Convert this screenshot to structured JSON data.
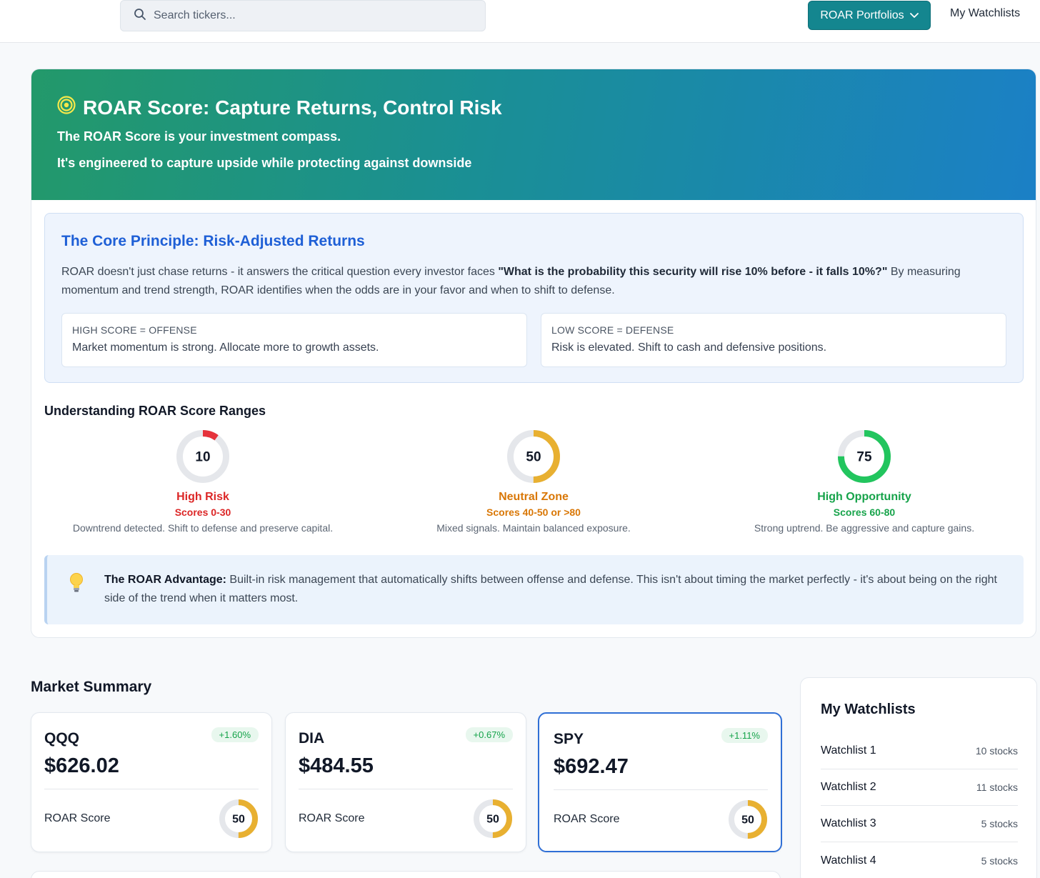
{
  "topbar": {
    "search_placeholder": "Search tickers...",
    "portfolios_label": "ROAR Portfolios",
    "watchlists_label": "My Watchlists"
  },
  "hero": {
    "title": "ROAR Score: Capture Returns, Control Risk",
    "subtitle1": "The ROAR Score is your investment compass.",
    "subtitle2": "It's engineered to capture upside while protecting against downside"
  },
  "principle": {
    "heading": "The Core Principle: Risk-Adjusted Returns",
    "text_before": "ROAR doesn't just chase returns - it answers the critical question every investor faces ",
    "question": "\"What is the probability this security will rise 10% before - it falls 10%?\"",
    "text_after": " By measuring momentum and trend strength, ROAR identifies when the odds are in your favor and when to shift to defense.",
    "offense_key": "HIGH SCORE = OFFENSE",
    "offense_text": "Market momentum is strong. Allocate more to growth assets.",
    "defense_key": "LOW SCORE = DEFENSE",
    "defense_text": "Risk is elevated. Shift to cash and defensive positions."
  },
  "ranges": {
    "title": "Understanding ROAR Score Ranges",
    "items": [
      {
        "score": "10",
        "value": 10,
        "name": "High Risk",
        "scores": "Scores 0-30",
        "desc": "Downtrend detected. Shift to defense and preserve capital.",
        "color": "#e5323b"
      },
      {
        "score": "50",
        "value": 50,
        "name": "Neutral Zone",
        "scores": "Scores 40-50 or >80",
        "desc": "Mixed signals. Maintain balanced exposure.",
        "color": "#e8b031"
      },
      {
        "score": "75",
        "value": 75,
        "name": "High Opportunity",
        "scores": "Scores 60-80",
        "desc": "Strong uptrend. Be aggressive and capture gains.",
        "color": "#22c55e"
      }
    ]
  },
  "advantage": {
    "label": "The ROAR Advantage:",
    "text": " Built-in risk management that automatically shifts between offense and defense. This isn't about timing the market perfectly - it's about being on the right side of the trend when it matters most."
  },
  "market": {
    "title": "Market Summary",
    "roar_label": "ROAR Score",
    "tickers": [
      {
        "symbol": "QQQ",
        "change": "+1.60%",
        "price": "$626.02",
        "score": "50",
        "value": 50
      },
      {
        "symbol": "DIA",
        "change": "+0.67%",
        "price": "$484.55",
        "score": "50",
        "value": 50
      },
      {
        "symbol": "SPY",
        "change": "+1.11%",
        "price": "$692.47",
        "score": "50",
        "value": 50
      }
    ]
  },
  "watchlists": {
    "title": "My Watchlists",
    "items": [
      {
        "name": "Watchlist 1",
        "count": "10 stocks"
      },
      {
        "name": "Watchlist 2",
        "count": "11 stocks"
      },
      {
        "name": "Watchlist 3",
        "count": "5 stocks"
      },
      {
        "name": "Watchlist 4",
        "count": "5 stocks"
      }
    ]
  },
  "colors": {
    "accent": "#14868f",
    "heading_blue": "#1e5fd6",
    "gauge_track": "#e5e7eb",
    "neutral_gauge": "#e8b031",
    "positive": "#15a34a",
    "risk_name": "#dc2626",
    "neutral_name": "#d97706",
    "opportunity_name": "#16a34a"
  }
}
